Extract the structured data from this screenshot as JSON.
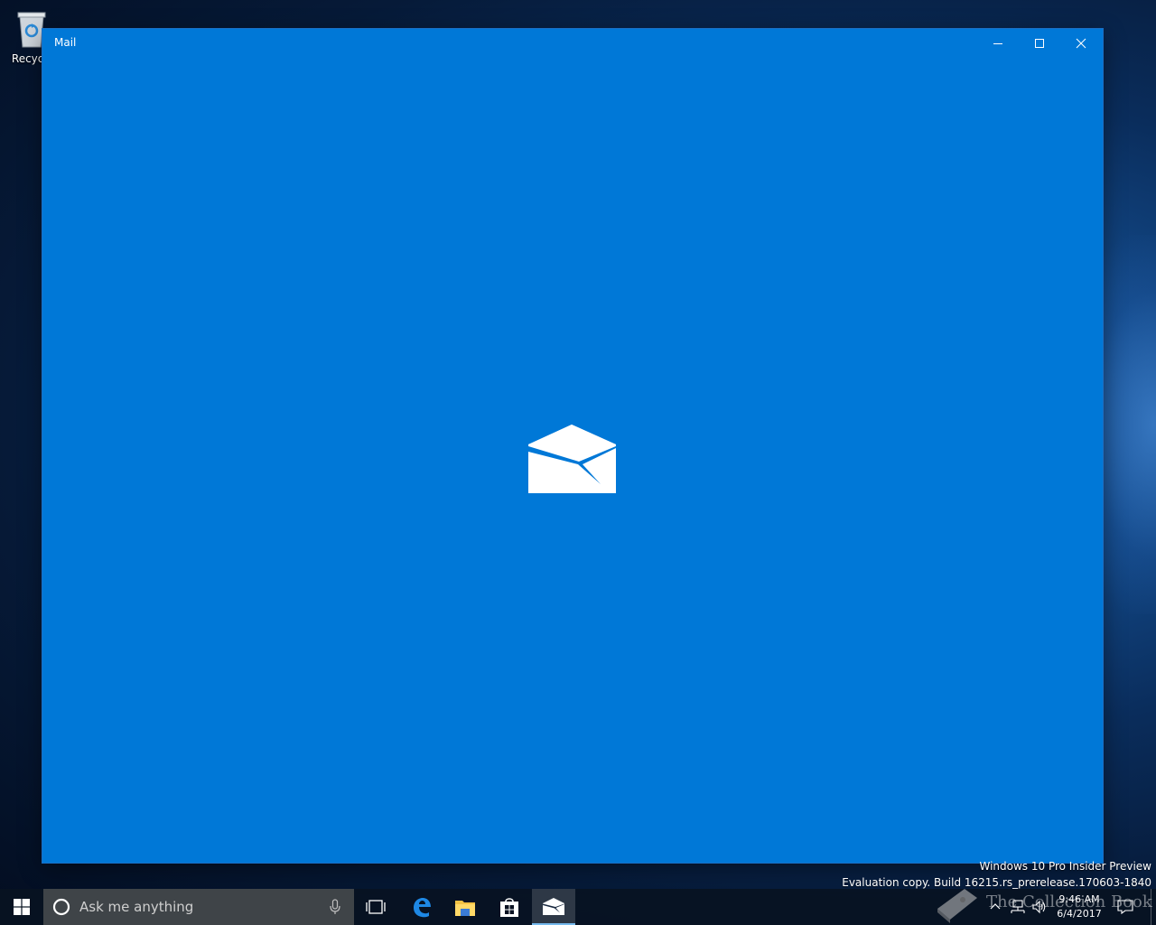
{
  "desktop": {
    "recycle_bin_label": "Recycle"
  },
  "window": {
    "title": "Mail",
    "accent_color": "#0078d7",
    "controls": {
      "minimize": "minimize-icon",
      "maximize": "maximize-icon",
      "close": "close-icon"
    },
    "splash_icon": "mail-envelope-icon"
  },
  "watermark": {
    "line1": "Windows 10 Pro Insider Preview",
    "line2": "Evaluation copy. Build 16215.rs_prerelease.170603-1840"
  },
  "taskbar": {
    "search": {
      "placeholder": "Ask me anything"
    },
    "pinned": [
      {
        "name": "task-view-icon"
      },
      {
        "name": "edge-icon"
      },
      {
        "name": "file-explorer-icon"
      },
      {
        "name": "store-icon"
      },
      {
        "name": "mail-icon",
        "active": true
      }
    ],
    "overlay_text": "The Collection Book",
    "clock": {
      "time": "9:46 AM",
      "date": "6/4/2017"
    }
  }
}
